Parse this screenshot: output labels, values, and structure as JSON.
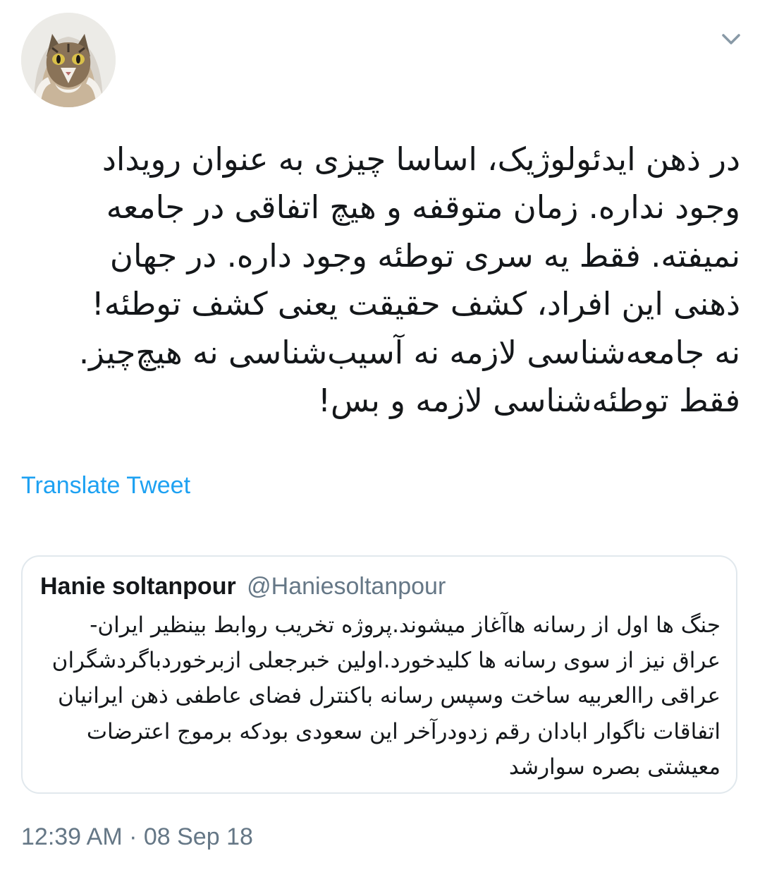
{
  "tweet": {
    "text": "در ذهن ایدئولوژیک، اساسا چیزی به عنوان رویداد\nوجود نداره. زمان متوقفه و هیچ اتفاقی در جامعه\nنمیفته. فقط یه سری توطئه وجود داره.  در جهان\nذهنی این افراد، کشف حقیقت یعنی کشف توطئه!\nنه جامعه‌شناسی لازمه نه آسیب‌شناسی نه هیچ‌چیز.\nفقط توطئه‌شناسی لازمه و بس!",
    "translate_label": "Translate Tweet",
    "timestamp": "12:39 AM · 08 Sep 18"
  },
  "quoted_tweet": {
    "name": "Hanie soltanpour",
    "handle": "@Haniesoltanpour",
    "text": "جنگ ها اول از رسانه هاآغاز میشوند.پروژه تخریب روابط بینظیر ایران-\nعراق نیز از سوی رسانه ها کلیدخورد.اولین خبرجعلی ازبرخوردباگردشگران\nعراقی راالعربیه ساخت وسپس رسانه باکنترل فضای عاطفی ذهن ایرانیان\nاتفاقات ناگوار ابادان رقم زدودرآخر این سعودی بودکه برموج اعترضات\nمعیشتی بصره سوارشد"
  },
  "icons": {
    "avatar": "cat-avatar",
    "menu": "chevron-down-icon"
  },
  "colors": {
    "link": "#1da1f2",
    "secondary_text": "#657786",
    "border": "#e1e8ed",
    "primary_text": "#14171a"
  }
}
